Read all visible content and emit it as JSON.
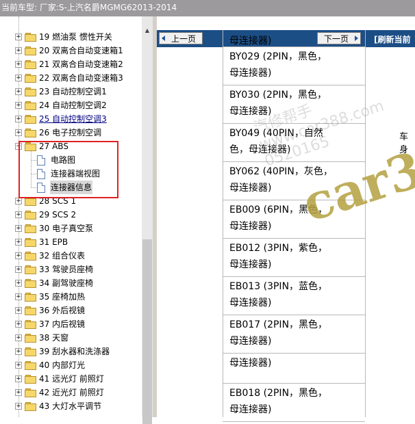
{
  "header": {
    "title": "当前车型:  厂家:S-上汽名爵MGMG62013-2014"
  },
  "tree": {
    "items": [
      {
        "label": "19 燃油泵 惯性开关",
        "link": false
      },
      {
        "label": "20 双离合自动变速箱1",
        "link": false
      },
      {
        "label": "21 双离合自动变速箱2",
        "link": false
      },
      {
        "label": "22 双离合自动变速箱3",
        "link": false
      },
      {
        "label": "23 自动控制空调1",
        "link": false
      },
      {
        "label": "24 自动控制空调2",
        "link": false
      },
      {
        "label": "25 自动控制空调3",
        "link": true
      },
      {
        "label": "26 电子控制空调",
        "link": false
      },
      {
        "label": "27 ABS",
        "link": false,
        "expanded": true
      },
      {
        "label": "28 SCS 1",
        "link": false
      },
      {
        "label": "29 SCS 2",
        "link": false
      },
      {
        "label": "30 电子真空泵",
        "link": false
      },
      {
        "label": "31 EPB",
        "link": false
      },
      {
        "label": "32 组合仪表",
        "link": false
      },
      {
        "label": "33 驾驶员座椅",
        "link": false
      },
      {
        "label": "34 副驾驶座椅",
        "link": false
      },
      {
        "label": "35 座椅加热",
        "link": false
      },
      {
        "label": "36 外后视镜",
        "link": false
      },
      {
        "label": "37 内后视镜",
        "link": false
      },
      {
        "label": "38 天窗",
        "link": false
      },
      {
        "label": "39 刮水器和洗涤器",
        "link": false
      },
      {
        "label": "40 内部灯光",
        "link": false
      },
      {
        "label": "41 远光灯 前照灯",
        "link": false
      },
      {
        "label": "42 近光灯 前照灯",
        "link": false
      },
      {
        "label": "43 大灯水平调节",
        "link": false
      }
    ],
    "subitems": [
      {
        "label": "电路图",
        "selected": false
      },
      {
        "label": "连接器端视图",
        "selected": false
      },
      {
        "label": "连接器信息",
        "selected": true
      }
    ]
  },
  "nav": {
    "prev_label": "上一页",
    "next_label": "下一页",
    "refresh_label": "[刷新当前"
  },
  "table": {
    "top_partial": "母连接器)",
    "rows": [
      {
        "line1": "BY029 (2PIN，黑色，",
        "line2": "母连接器)"
      },
      {
        "line1": "BY030 (2PIN，黑色，",
        "line2": "母连接器)"
      },
      {
        "line1": "BY049 (40PIN，自然",
        "line2": "色，母连接器)",
        "extra": "车身"
      },
      {
        "line1": "BY062 (40PIN，灰色，",
        "line2": "母连接器)"
      },
      {
        "line1": "EB009 (6PIN，黑色，",
        "line2": "母连接器)"
      },
      {
        "line1": "EB012 (3PIN，紫色，",
        "line2": "母连接器)"
      },
      {
        "line1": "EB013 (3PIN，蓝色，",
        "line2": "母连接器)"
      },
      {
        "line1": "EB017 (2PIN，黑色，",
        "line2": "母连接器)"
      },
      {
        "line1": "母连接器)",
        "line2": ""
      },
      {
        "line1": "EB018 (2PIN，黑色，",
        "line2": "母连接器)"
      }
    ]
  },
  "watermark": {
    "text1": "汽修帮手 www.car388.com 0520165",
    "text2": "car3"
  },
  "colors": {
    "nav_bar": "#1c4e86",
    "top_bar": "#9c9a9c",
    "highlight": "#e02020"
  }
}
